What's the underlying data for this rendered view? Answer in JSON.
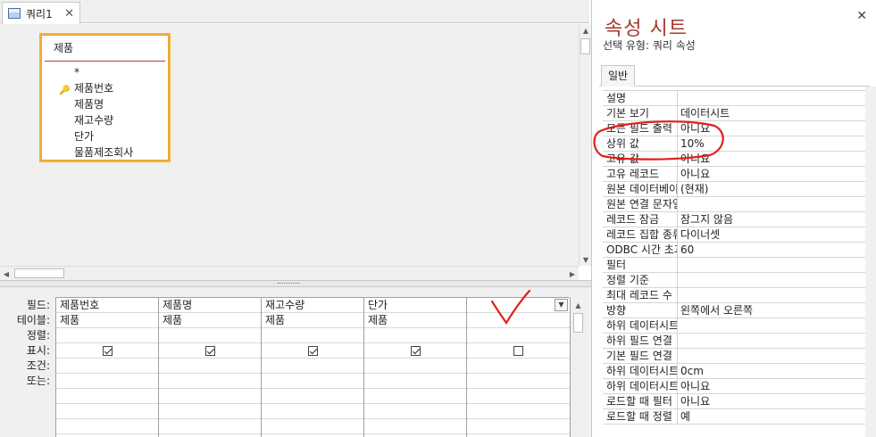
{
  "tab": {
    "label": "쿼리1",
    "close": "✕"
  },
  "field_list": {
    "title": "제품",
    "items": [
      "*",
      "제품번호",
      "제품명",
      "재고수량",
      "단가",
      "물품제조회사"
    ]
  },
  "qbe": {
    "row_labels": [
      "필드:",
      "테이블:",
      "정렬:",
      "표시:",
      "조건:",
      "또는:"
    ],
    "columns": [
      {
        "field": "제품번호",
        "table": "제품",
        "show": true
      },
      {
        "field": "제품명",
        "table": "제품",
        "show": true
      },
      {
        "field": "재고수량",
        "table": "제품",
        "show": true
      },
      {
        "field": "단가",
        "table": "제품",
        "show": true
      },
      {
        "field": "",
        "table": "",
        "show": false
      }
    ]
  },
  "property_sheet": {
    "title": "속성 시트",
    "selection_type": "선택 유형: 쿼리 속성",
    "tab": "일반",
    "close": "✕",
    "rows": [
      {
        "name": "설명",
        "value": ""
      },
      {
        "name": "기본 보기",
        "value": "데이터시트"
      },
      {
        "name": "모든 필드 출력",
        "value": "아니요"
      },
      {
        "name": "상위 값",
        "value": "10%"
      },
      {
        "name": "고유 값",
        "value": "아니요"
      },
      {
        "name": "고유 레코드",
        "value": "아니요"
      },
      {
        "name": "원본 데이터베이스",
        "value": "(현재)"
      },
      {
        "name": "원본 연결 문자열",
        "value": ""
      },
      {
        "name": "레코드 잠금",
        "value": "잠그지 않음"
      },
      {
        "name": "레코드 집합 종류",
        "value": "다이너셋"
      },
      {
        "name": "ODBC 시간 초과",
        "value": "60"
      },
      {
        "name": "필터",
        "value": ""
      },
      {
        "name": "정렬 기준",
        "value": ""
      },
      {
        "name": "최대 레코드 수",
        "value": ""
      },
      {
        "name": "방향",
        "value": "왼쪽에서 오른쪽"
      },
      {
        "name": "하위 데이터시트 이름",
        "value": ""
      },
      {
        "name": "하위 필드 연결",
        "value": ""
      },
      {
        "name": "기본 필드 연결",
        "value": ""
      },
      {
        "name": "하위 데이터시트 높이",
        "value": "0cm"
      },
      {
        "name": "하위 데이터시트 확장",
        "value": "아니요"
      },
      {
        "name": "로드할 때 필터",
        "value": "아니요"
      },
      {
        "name": "로드할 때 정렬",
        "value": "예"
      }
    ]
  },
  "colors": {
    "annotation": "#e0201a",
    "title": "#a33b2d",
    "field_list_border": "#f2b33d"
  },
  "icons": {
    "tab": "query-icon",
    "key": "primary-key-icon",
    "dropdown": "chevron-down-icon"
  }
}
